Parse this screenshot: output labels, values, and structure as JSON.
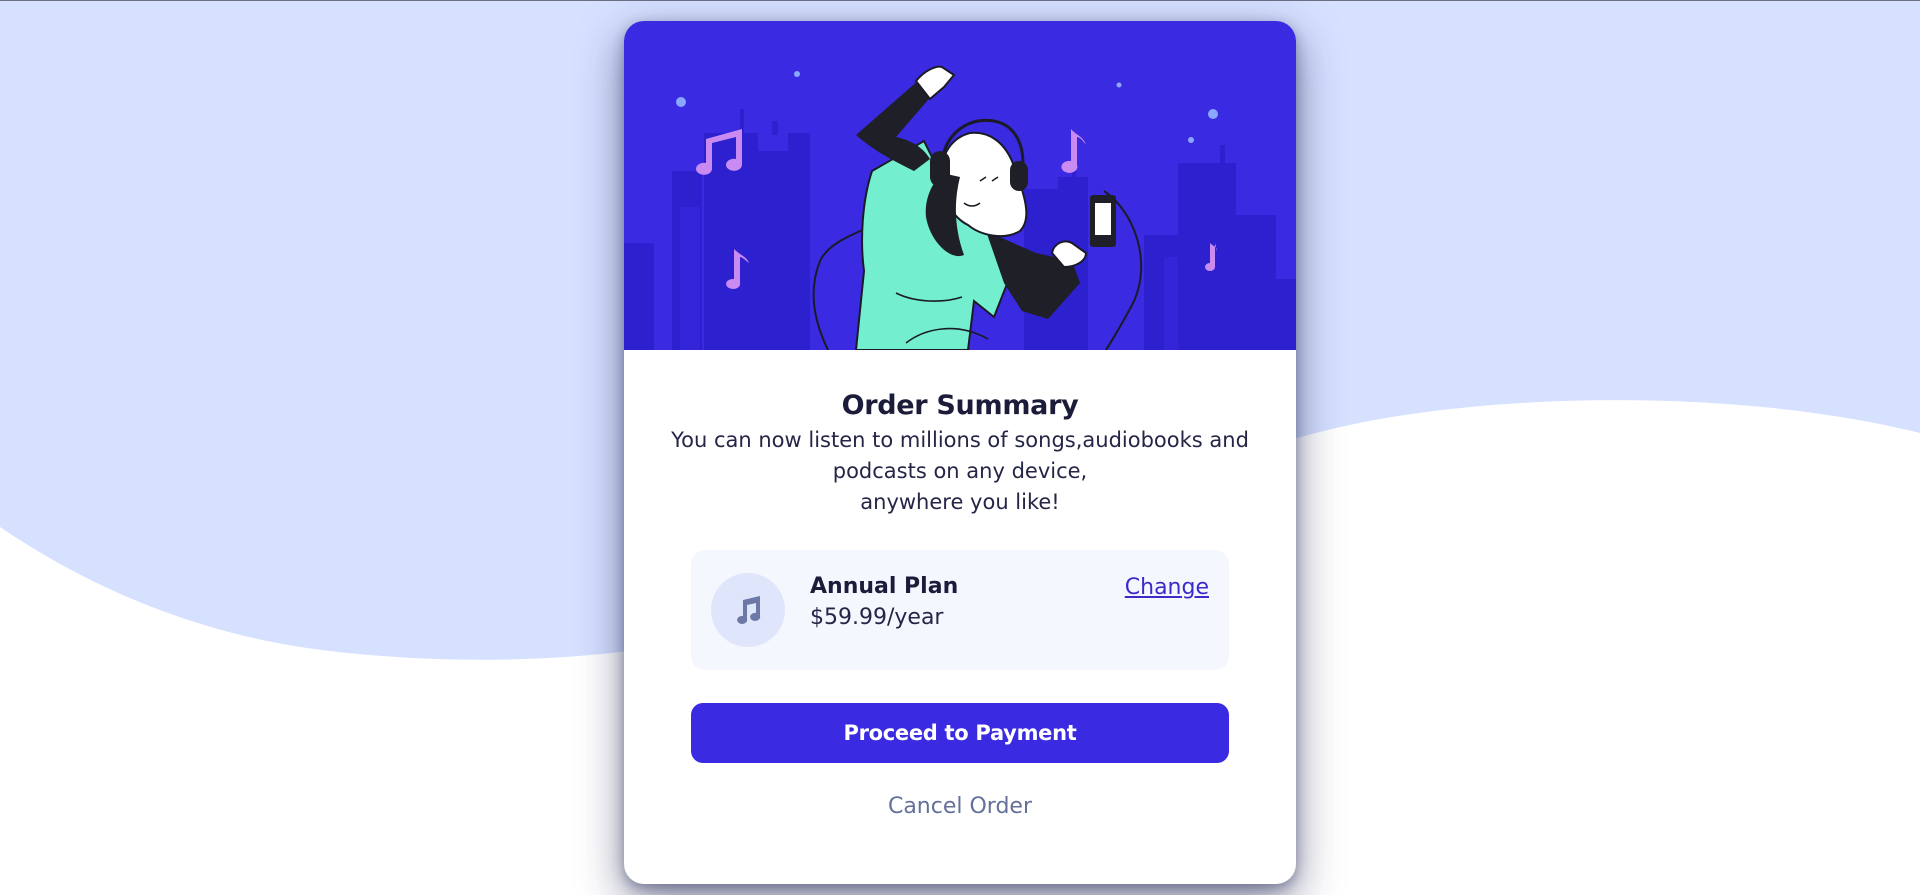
{
  "summary": {
    "title": "Order Summary",
    "description_line1": "You can now listen to millions of songs,audiobooks and",
    "description_line2": "podcasts on any device,",
    "description_line3": "anywhere you like!"
  },
  "plan": {
    "name": "Annual Plan",
    "price": "$59.99/year",
    "change_label": "Change",
    "icon": "music-note-icon"
  },
  "actions": {
    "proceed_label": "Proceed to Payment",
    "cancel_label": "Cancel Order"
  },
  "colors": {
    "background_wave": "#d6e0ff",
    "hero": "#3a2ae2",
    "primary_button": "#3a2ae2",
    "cancel_text": "#65709a",
    "plan_box": "#f5f7ff"
  }
}
